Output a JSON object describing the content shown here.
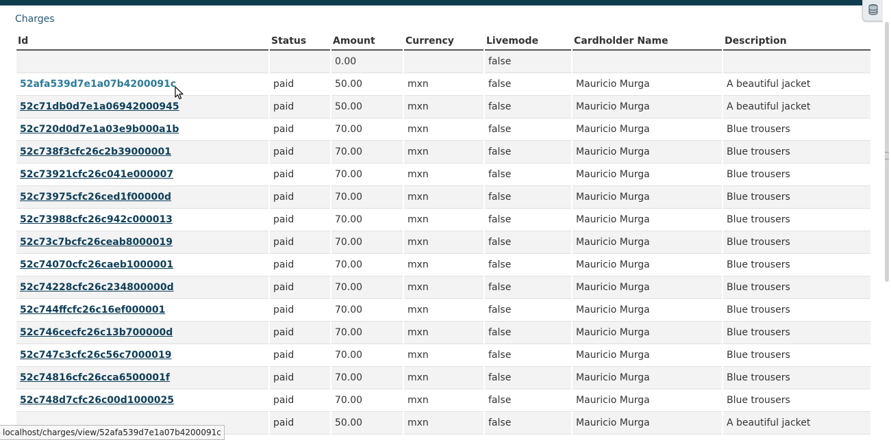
{
  "page": {
    "heading": "Charges"
  },
  "table": {
    "columns": [
      "Id",
      "Status",
      "Amount",
      "Currency",
      "Livemode",
      "Cardholder Name",
      "Description"
    ],
    "rows": [
      {
        "id": "",
        "status": "",
        "amount": "0.00",
        "currency": "",
        "livemode": "false",
        "cardholder": "",
        "description": ""
      },
      {
        "id": "52afa539d7e1a07b4200091c",
        "status": "paid",
        "amount": "50.00",
        "currency": "mxn",
        "livemode": "false",
        "cardholder": "Mauricio Murga",
        "description": "A beautiful jacket"
      },
      {
        "id": "52c71db0d7e1a06942000945",
        "status": "paid",
        "amount": "50.00",
        "currency": "mxn",
        "livemode": "false",
        "cardholder": "Mauricio Murga",
        "description": "A beautiful jacket"
      },
      {
        "id": "52c720d0d7e1a03e9b000a1b",
        "status": "paid",
        "amount": "70.00",
        "currency": "mxn",
        "livemode": "false",
        "cardholder": "Mauricio Murga",
        "description": "Blue trousers"
      },
      {
        "id": "52c738f3cfc26c2b39000001",
        "status": "paid",
        "amount": "70.00",
        "currency": "mxn",
        "livemode": "false",
        "cardholder": "Mauricio Murga",
        "description": "Blue trousers"
      },
      {
        "id": "52c73921cfc26c041e000007",
        "status": "paid",
        "amount": "70.00",
        "currency": "mxn",
        "livemode": "false",
        "cardholder": "Mauricio Murga",
        "description": "Blue trousers"
      },
      {
        "id": "52c73975cfc26ced1f00000d",
        "status": "paid",
        "amount": "70.00",
        "currency": "mxn",
        "livemode": "false",
        "cardholder": "Mauricio Murga",
        "description": "Blue trousers"
      },
      {
        "id": "52c73988cfc26c942c000013",
        "status": "paid",
        "amount": "70.00",
        "currency": "mxn",
        "livemode": "false",
        "cardholder": "Mauricio Murga",
        "description": "Blue trousers"
      },
      {
        "id": "52c73c7bcfc26ceab8000019",
        "status": "paid",
        "amount": "70.00",
        "currency": "mxn",
        "livemode": "false",
        "cardholder": "Mauricio Murga",
        "description": "Blue trousers"
      },
      {
        "id": "52c74070cfc26caeb1000001",
        "status": "paid",
        "amount": "70.00",
        "currency": "mxn",
        "livemode": "false",
        "cardholder": "Mauricio Murga",
        "description": "Blue trousers"
      },
      {
        "id": "52c74228cfc26c234800000d",
        "status": "paid",
        "amount": "70.00",
        "currency": "mxn",
        "livemode": "false",
        "cardholder": "Mauricio Murga",
        "description": "Blue trousers"
      },
      {
        "id": "52c744ffcfc26c16ef000001",
        "status": "paid",
        "amount": "70.00",
        "currency": "mxn",
        "livemode": "false",
        "cardholder": "Mauricio Murga",
        "description": "Blue trousers"
      },
      {
        "id": "52c746cecfc26c13b700000d",
        "status": "paid",
        "amount": "70.00",
        "currency": "mxn",
        "livemode": "false",
        "cardholder": "Mauricio Murga",
        "description": "Blue trousers"
      },
      {
        "id": "52c747c3cfc26c56c7000019",
        "status": "paid",
        "amount": "70.00",
        "currency": "mxn",
        "livemode": "false",
        "cardholder": "Mauricio Murga",
        "description": "Blue trousers"
      },
      {
        "id": "52c74816cfc26cca6500001f",
        "status": "paid",
        "amount": "70.00",
        "currency": "mxn",
        "livemode": "false",
        "cardholder": "Mauricio Murga",
        "description": "Blue trousers"
      },
      {
        "id": "52c748d7cfc26c00d1000025",
        "status": "paid",
        "amount": "70.00",
        "currency": "mxn",
        "livemode": "false",
        "cardholder": "Mauricio Murga",
        "description": "Blue trousers"
      },
      {
        "id": "",
        "status": "paid",
        "amount": "50.00",
        "currency": "mxn",
        "livemode": "false",
        "cardholder": "Mauricio Murga",
        "description": "A beautiful jacket"
      }
    ],
    "hovered_row": 1
  },
  "statusbar": {
    "url": "localhost/charges/view/52afa539d7e1a07b4200091c"
  },
  "icons": {
    "toolbar": "database-icon",
    "pointer": "mouse-cursor-icon"
  },
  "colors": {
    "topbar": "#0f3d4f",
    "link": "#0d3f5a",
    "link_hover": "#2b7a9a",
    "row_alt": "#f3f3f3"
  }
}
